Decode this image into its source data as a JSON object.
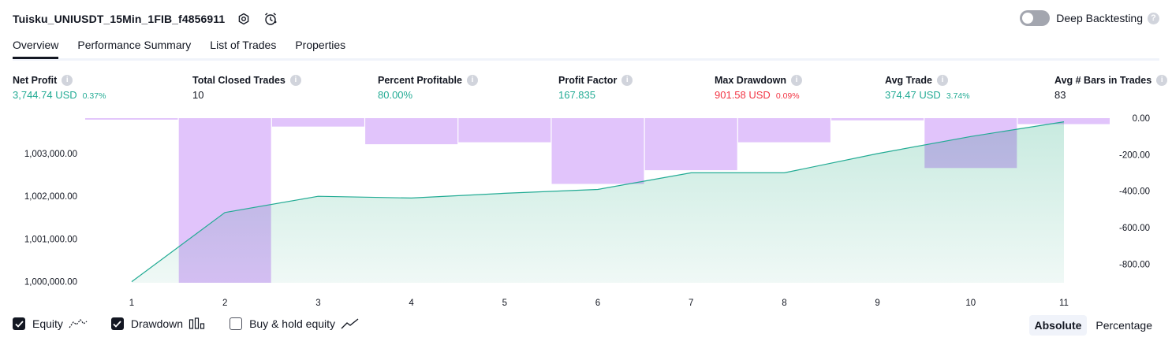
{
  "header": {
    "strategy_name": "Tuisku_UNIUSDT_15Min_1FIB_f4856911",
    "deep_backtesting_label": "Deep Backtesting",
    "deep_backtesting_enabled": false
  },
  "tabs": [
    {
      "label": "Overview",
      "active": true
    },
    {
      "label": "Performance Summary",
      "active": false
    },
    {
      "label": "List of Trades",
      "active": false
    },
    {
      "label": "Properties",
      "active": false
    }
  ],
  "metrics": {
    "net_profit": {
      "label": "Net Profit",
      "value": "3,744.74 USD",
      "pct": "0.37%"
    },
    "total_closed_trades": {
      "label": "Total Closed Trades",
      "value": "10"
    },
    "percent_profitable": {
      "label": "Percent Profitable",
      "value": "80.00%"
    },
    "profit_factor": {
      "label": "Profit Factor",
      "value": "167.835"
    },
    "max_drawdown": {
      "label": "Max Drawdown",
      "value": "901.58 USD",
      "pct": "0.09%"
    },
    "avg_trade": {
      "label": "Avg Trade",
      "value": "374.47 USD",
      "pct": "3.74%"
    },
    "avg_bars": {
      "label": "Avg # Bars in Trades",
      "value": "83"
    }
  },
  "colors": {
    "profit": "#22ab94",
    "loss": "#f23645",
    "drawdown_bar": "#e1c4fb",
    "equity_line": "#22ab94",
    "equity_fill_top": "#c2e8dc",
    "equity_fill_bottom": "#eef8f5"
  },
  "chart_data": {
    "type": "line",
    "x": [
      1,
      2,
      3,
      4,
      5,
      6,
      7,
      8,
      9,
      10,
      11
    ],
    "left_axis_ticks": [
      "1,003,000.00",
      "1,002,000.00",
      "1,001,000.00",
      "1,000,000.00"
    ],
    "right_axis_ticks": [
      "0.00",
      "-200.00",
      "-400.00",
      "-600.00",
      "-800.00"
    ],
    "left_ylim": [
      999975,
      1003830
    ],
    "right_ylim": [
      -901.58,
      0
    ],
    "series": [
      {
        "name": "Equity",
        "axis": "left",
        "values": [
          1000000,
          1001620,
          1002000,
          1001960,
          1002070,
          1002160,
          1002550,
          1002550,
          1003000,
          1003400,
          1003744.74
        ]
      },
      {
        "name": "Drawdown",
        "axis": "right",
        "type": "bar",
        "values": [
          -8,
          -901.58,
          -46,
          -143,
          -132,
          -360,
          -285,
          -132,
          -12,
          -273,
          -33
        ]
      },
      {
        "name": "Buy & hold equity",
        "axis": "left",
        "values": []
      }
    ]
  },
  "legend": {
    "items": [
      {
        "label": "Equity",
        "checked": true,
        "icon": "equity-line-icon"
      },
      {
        "label": "Drawdown",
        "checked": true,
        "icon": "drawdown-bars-icon"
      },
      {
        "label": "Buy & hold equity",
        "checked": false,
        "icon": "buy-hold-line-icon"
      }
    ]
  },
  "mode": {
    "options": [
      "Absolute",
      "Percentage"
    ],
    "selected": "Absolute"
  }
}
